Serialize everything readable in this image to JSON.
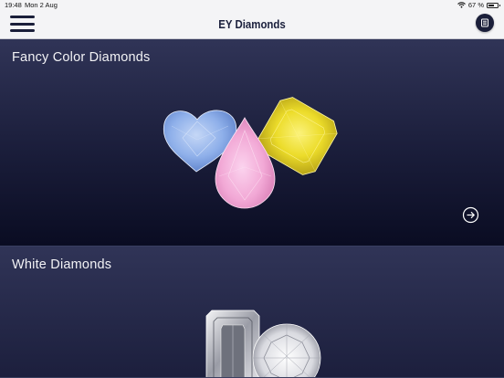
{
  "status_bar": {
    "time": "19:48",
    "date": "Mon 2 Aug",
    "battery_percent": "67 %",
    "battery_level": 0.67
  },
  "nav": {
    "title": "EY Diamonds"
  },
  "cards": [
    {
      "title": "Fancy Color Diamonds"
    },
    {
      "title": "White Diamonds"
    }
  ],
  "colors": {
    "navy": "#1b1f3a",
    "blue_diamond": "#8fb0ea",
    "pink_diamond": "#f2a9d6",
    "yellow_diamond": "#ecdc2a"
  }
}
